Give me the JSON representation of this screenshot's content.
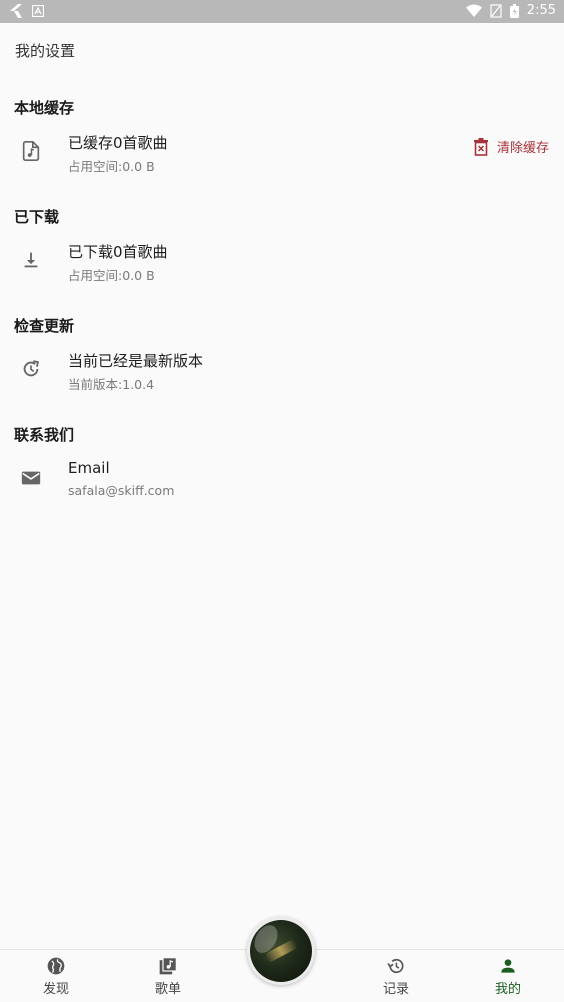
{
  "status_bar": {
    "time": "2:55"
  },
  "page": {
    "title": "我的设置"
  },
  "sections": {
    "cache": {
      "title": "本地缓存",
      "primary": "已缓存0首歌曲",
      "secondary": "占用空间:0.0 B",
      "action_label": "清除缓存"
    },
    "downloaded": {
      "title": "已下载",
      "primary": "已下载0首歌曲",
      "secondary": "占用空间:0.0 B"
    },
    "update": {
      "title": "检查更新",
      "primary": "当前已经是最新版本",
      "secondary": "当前版本:1.0.4"
    },
    "contact": {
      "title": "联系我们",
      "primary": "Email",
      "secondary": "safala@skiff.com"
    }
  },
  "bottom_nav": {
    "items": [
      {
        "label": "发现",
        "icon": "globe-icon"
      },
      {
        "label": "歌单",
        "icon": "playlist-icon"
      },
      {
        "label": "记录",
        "icon": "history-icon"
      },
      {
        "label": "我的",
        "icon": "person-icon"
      }
    ],
    "active": "我的"
  },
  "colors": {
    "accent_active": "#1b5e20",
    "danger": "#a8323a",
    "background": "#fafafa",
    "status_bar": "#b8b8b8"
  }
}
